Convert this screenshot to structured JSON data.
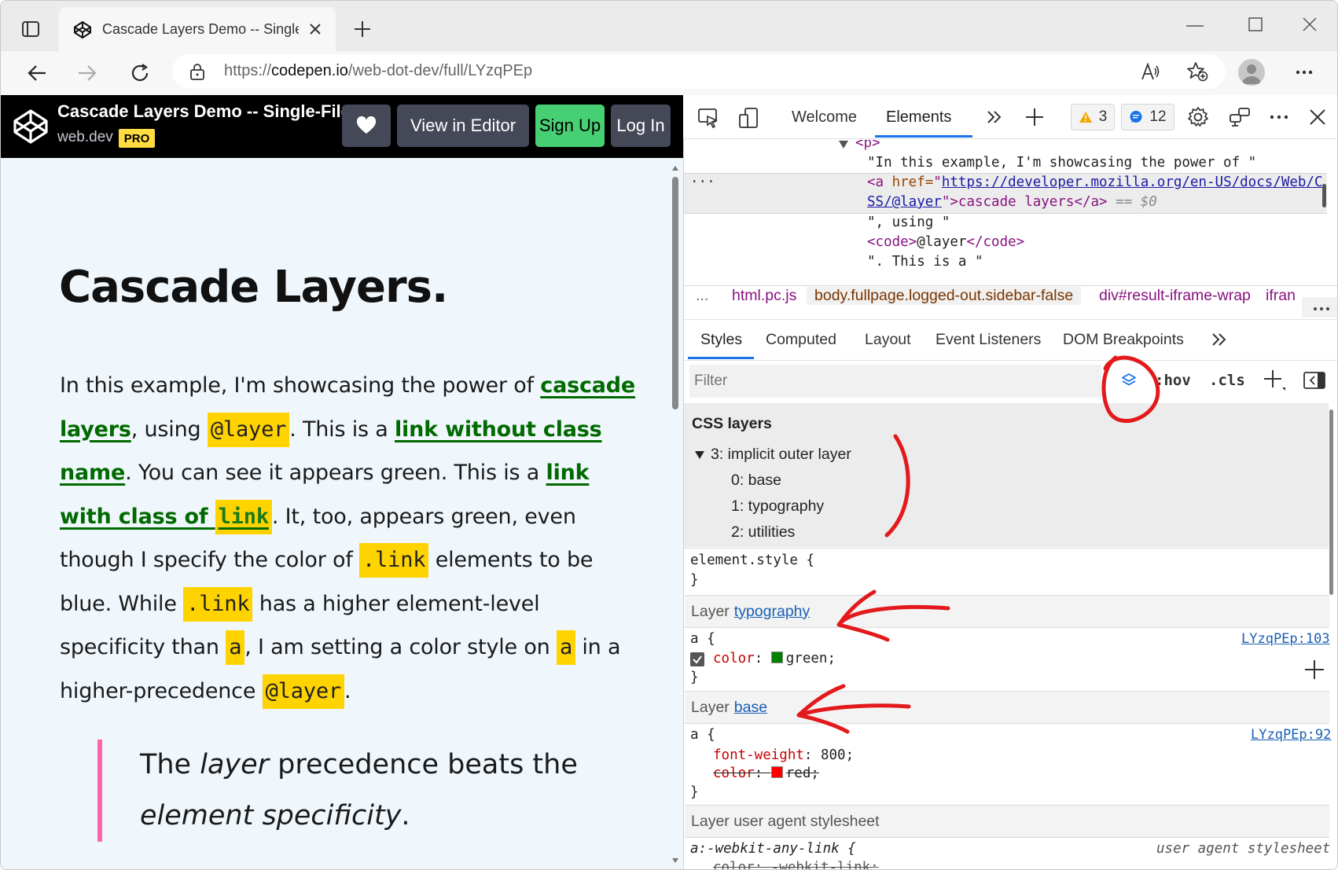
{
  "browser": {
    "tab_title": "Cascade Layers Demo -- Single-F",
    "url_prefix": "https://",
    "url_host": "codepen.io",
    "url_path": "/web-dot-dev/full/LYzqPEp"
  },
  "codepen": {
    "title": "Cascade Layers Demo -- Single-File",
    "author": "web.dev",
    "pro_badge": "PRO",
    "view_in_editor": "View in Editor",
    "sign_up": "Sign Up",
    "log_in": "Log In"
  },
  "page": {
    "heading": "Cascade Layers.",
    "p1": "In this example, I'm showcasing the power of ",
    "link_cascade": "cascade layers",
    "p2": ", using ",
    "code_layer": "@layer",
    "p3": ". This is a ",
    "link_noclass": "link without class name",
    "p4": ". You can see it appears green. This is a ",
    "link_withclass": "link with class of ",
    "code_link": "link",
    "p5": ". It, too, appears green, even though I specify the color of ",
    "code_dotlink": ".link",
    "p6": " elements to be blue. While ",
    "code_dotlink2": ".link",
    "p7": " has a higher element-level specificity than ",
    "code_a": "a",
    "p8": ", I am setting a color style on ",
    "code_a2": "a",
    "p9": " in a higher-precedence ",
    "code_layer2": "@layer",
    "p10": ".",
    "quote_1": "The ",
    "quote_em1": "layer",
    "quote_2": " precedence beats the ",
    "quote_em2": "element specificity",
    "quote_3": "."
  },
  "devtools": {
    "tab_welcome": "Welcome",
    "tab_elements": "Elements",
    "warnings": "3",
    "messages": "12",
    "dom": {
      "p_tag": "<p>",
      "text1": "\"In this example, I'm showcasing the power of \"",
      "a_open": "<a",
      "href_attr": " href=",
      "href_q1": "\"",
      "href_val1": "https://developer.mozilla.org/en-US/docs/Web/C",
      "href_val2": "SS/@layer",
      "href_q2": "\"",
      "a_text": ">cascade layers</a>",
      "eq0": " == $0",
      "text2": "\", using \"",
      "code_open": "<code>",
      "code_text": "@layer",
      "code_close": "</code>",
      "text3": "\". This is a \""
    },
    "breadcrumbs": [
      "...",
      "html.pc.js",
      "body.fullpage.logged-out.sidebar-false",
      "div#result-iframe-wrap",
      "ifran"
    ],
    "styles_tabs": [
      "Styles",
      "Computed",
      "Layout",
      "Event Listeners",
      "DOM Breakpoints"
    ],
    "filter_placeholder": "Filter",
    "hov": ":hov",
    "cls": ".cls",
    "css_layers_title": "CSS layers",
    "layers": [
      "3: implicit outer layer",
      "0: base",
      "1: typography",
      "2: utilities"
    ],
    "element_style": "element.style {",
    "close_brace": "}",
    "layer_label": "Layer",
    "layer_typography": "typography",
    "layer_base": "base",
    "layer_ua": "Layer user agent stylesheet",
    "rule1_selector": "a {",
    "rule1_prop": "color",
    "rule1_value": "green;",
    "rule1_source": "LYzqPEp:103",
    "rule2_selector": "a {",
    "rule2_prop1": "font-weight",
    "rule2_value1": "800;",
    "rule2_prop2": "color",
    "rule2_value2": "red;",
    "rule2_source": "LYzqPEp:92",
    "ua_selector": "a:-webkit-any-link {",
    "ua_source": "user agent stylesheet",
    "ua_partial": "color: -webkit-link;",
    "colors": {
      "green": "#008000",
      "red": "#ff0000",
      "accent": "#1a5fb4"
    }
  }
}
